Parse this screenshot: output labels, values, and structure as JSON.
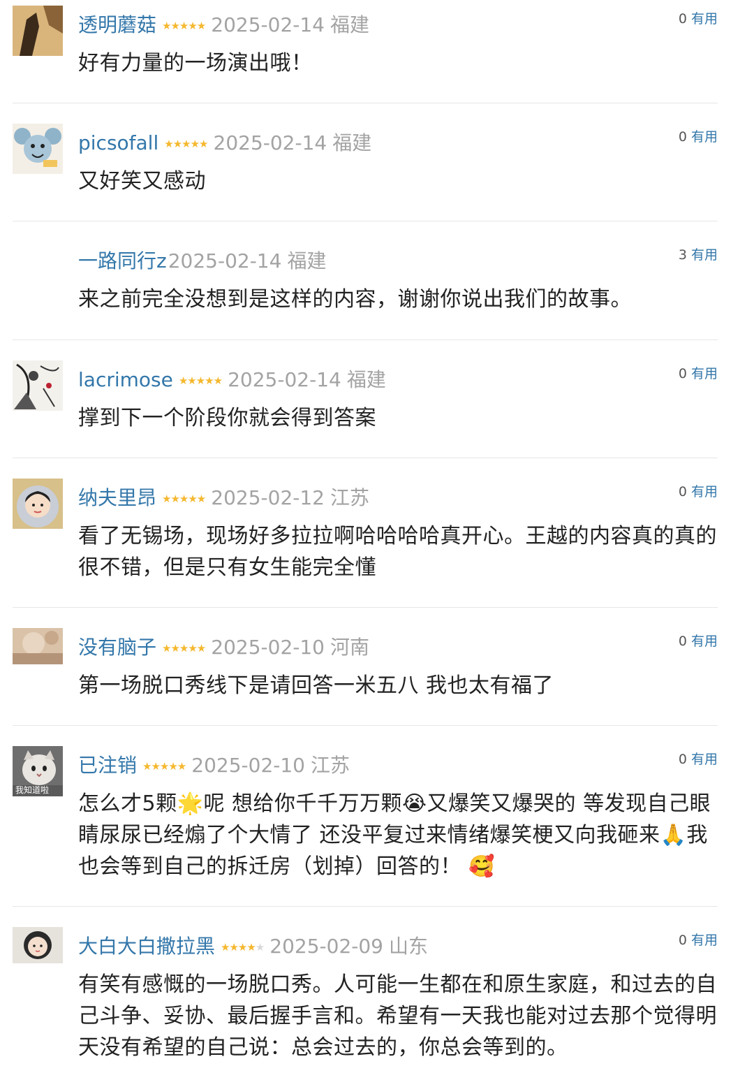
{
  "vote_label": "有用",
  "reviews": [
    {
      "user": "透明蘑菇",
      "stars": "★★★★★",
      "stars_off": "",
      "date": "2025-02-14",
      "location": "福建",
      "votes": "0",
      "text": "好有力量的一场演出哦！",
      "avatar": "shadow-figure-icon"
    },
    {
      "user": "picsofall",
      "stars": "★★★★★",
      "stars_off": "",
      "date": "2025-02-14",
      "location": "福建",
      "votes": "0",
      "text": "又好笑又感动",
      "avatar": "cartoon-mouse-icon"
    },
    {
      "user": "一路同行z",
      "stars": "",
      "stars_off": "",
      "date": "2025-02-14",
      "location": "福建",
      "votes": "3",
      "text": "来之前完全没想到是这样的内容，谢谢你说出我们的故事。",
      "avatar": ""
    },
    {
      "user": "lacrimose",
      "stars": "★★★★★",
      "stars_off": "",
      "date": "2025-02-14",
      "location": "福建",
      "votes": "0",
      "text": "撑到下一个阶段你就会得到答案",
      "avatar": "ink-painting-icon"
    },
    {
      "user": "纳夫里昂",
      "stars": "★★★★★",
      "stars_off": "",
      "date": "2025-02-12",
      "location": "江苏",
      "votes": "0",
      "text": "看了无锡场，现场好多拉拉啊哈哈哈哈真开心。王越的内容真的真的很不错，但是只有女生能完全懂",
      "avatar": "girl-hood-icon"
    },
    {
      "user": "没有脑子",
      "stars": "★★★★★",
      "stars_off": "",
      "date": "2025-02-10",
      "location": "河南",
      "votes": "0",
      "text": "第一场脱口秀线下是请回答一米五八 我也太有福了",
      "avatar": "blurry-photo-icon"
    },
    {
      "user": "已注销",
      "stars": "★★★★★",
      "stars_off": "",
      "date": "2025-02-10",
      "location": "江苏",
      "votes": "0",
      "text": "怎么才5颗🌟呢 想给你千千万万颗😭又爆笑又爆哭的 等发现自己眼睛尿尿已经煽了个大情了 还没平复过来情绪爆笑梗又向我砸来🙏我也会等到自己的拆迁房（划掉）回答的！ 🥰",
      "avatar": "cat-icon",
      "avatar_caption": "我知道啦"
    },
    {
      "user": "大白大白撒拉黑",
      "stars": "★★★★",
      "stars_off": "★",
      "date": "2025-02-09",
      "location": "山东",
      "votes": "0",
      "text": "有笑有感慨的一场脱口秀。人可能一生都在和原生家庭，和过去的自己斗争、妥协、最后握手言和。希望有一天我也能对过去那个觉得明天没有希望的自己说：总会过去的，你总会等到的。",
      "avatar": "girl-portrait-icon"
    }
  ]
}
